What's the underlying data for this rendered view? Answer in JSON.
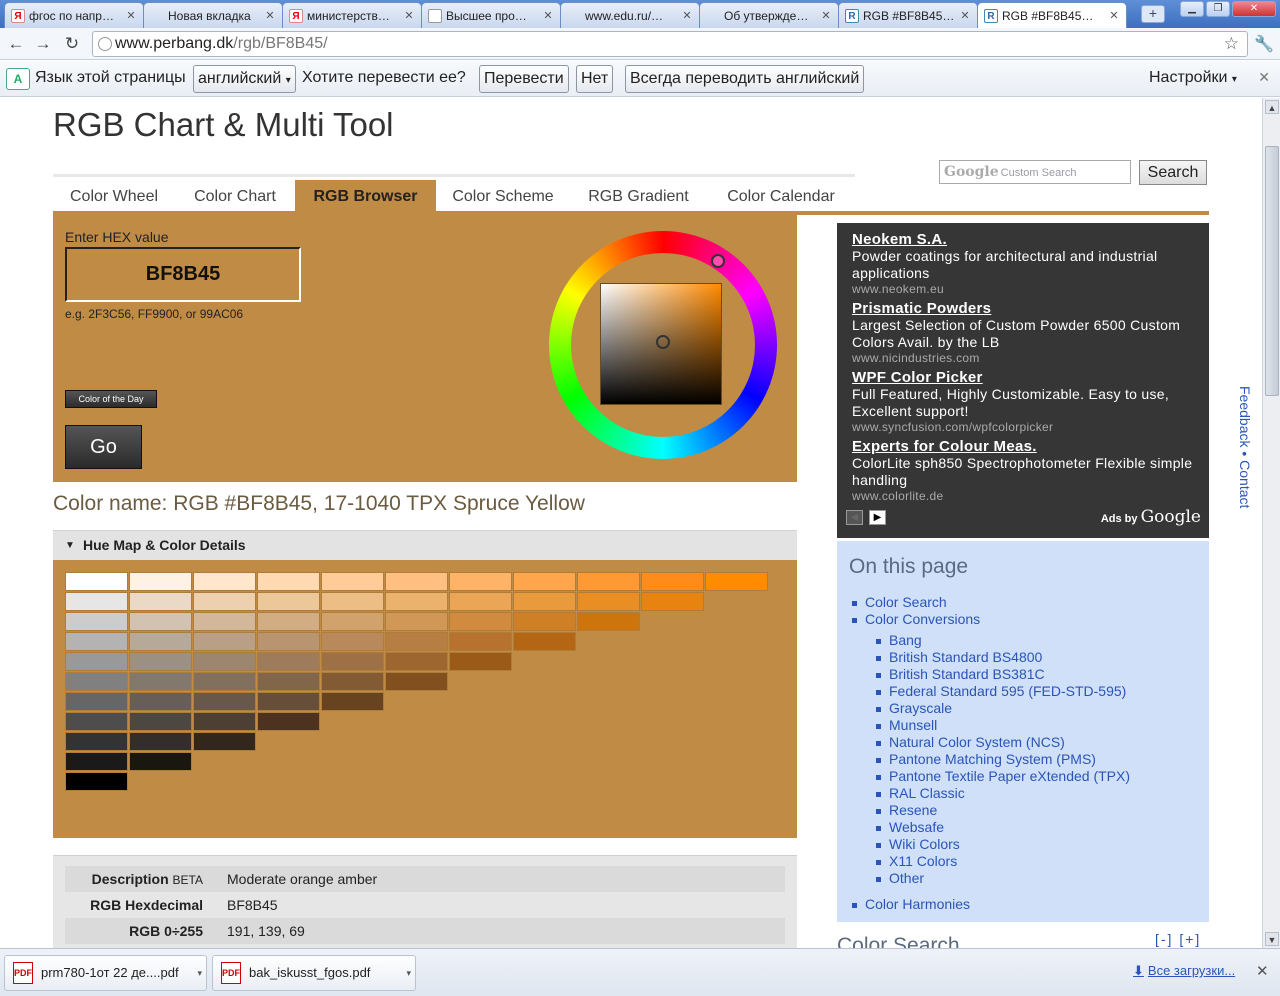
{
  "browser": {
    "tabs": [
      {
        "title": "фгос по напр…",
        "icon": "Я",
        "kind": "y"
      },
      {
        "title": "Новая вкладка",
        "icon": "",
        "kind": "e"
      },
      {
        "title": "министерств…",
        "icon": "Я",
        "kind": "y"
      },
      {
        "title": "Высшее про…",
        "icon": "",
        "kind": "d"
      },
      {
        "title": "www.edu.ru/…",
        "icon": "",
        "kind": "e"
      },
      {
        "title": "Об утвержде…",
        "icon": "",
        "kind": "e"
      },
      {
        "title": "RGB #BF8B45…",
        "icon": "R",
        "kind": "r"
      },
      {
        "title": "RGB #BF8B45…",
        "icon": "R",
        "kind": "r",
        "active": true
      }
    ],
    "newtab_label": "+",
    "url_domain": "www.perbang.dk",
    "url_path": "/rgb/BF8B45/"
  },
  "translate_bar": {
    "prompt": "Язык этой страницы",
    "language": "английский",
    "question": "Хотите перевести ее?",
    "translate": "Перевести",
    "no": "Нет",
    "always": "Всегда переводить английский",
    "settings": "Настройки"
  },
  "site": {
    "title": "RGB Chart & Multi Tool",
    "search_logo": "Google",
    "search_placeholder": "Custom Search",
    "search_button": "Search",
    "nav": [
      "Color Wheel",
      "Color Chart",
      "RGB Browser",
      "Color Scheme",
      "RGB Gradient",
      "Color Calendar"
    ],
    "nav_active": 2
  },
  "tool": {
    "hex_label": "Enter HEX value",
    "hex_value": "BF8B45",
    "hex_example": "e.g. 2F3C56, FF9900, or 99AC06",
    "cotd_label": "Color of the Day",
    "go_label": "Go",
    "color": "#bf8b45"
  },
  "color_name": "Color name: RGB #BF8B45, 17-1040 TPX Spruce Yellow",
  "huemap": {
    "header": "Hue Map & Color Details",
    "rows": [
      [
        "#ffffff",
        "#fff2e5",
        "#ffe6cc",
        "#ffd9b2",
        "#ffcc99",
        "#ffbf80",
        "#ffb366",
        "#ffa64d",
        "#ff9933",
        "#ff8c1a",
        "#ff8c00"
      ],
      [
        "#e6e6e6",
        "#ebd9c8",
        "#ecd0b0",
        "#ecc79a",
        "#ecbd84",
        "#ebb26d",
        "#eaa656",
        "#e99a3d",
        "#e88e24",
        "#e7840f"
      ],
      [
        "#cccccc",
        "#d1c2b1",
        "#d2b79a",
        "#d2ad84",
        "#d2a26d",
        "#d19756",
        "#d08b3f",
        "#cf7f26",
        "#ce740c"
      ],
      [
        "#b3b3b3",
        "#b7a99a",
        "#b89f86",
        "#b89470",
        "#b8895a",
        "#b77e44",
        "#b6722e",
        "#b56614"
      ],
      [
        "#999999",
        "#9c9083",
        "#9d8670",
        "#9d7b5b",
        "#9d7046",
        "#9d6530",
        "#9b5a17"
      ],
      [
        "#808080",
        "#82786d",
        "#82705e",
        "#826649",
        "#825b35",
        "#82501f"
      ],
      [
        "#666666",
        "#675f57",
        "#67584a",
        "#674e38",
        "#67441f"
      ],
      [
        "#4d4d4d",
        "#4d4741",
        "#4d3f33",
        "#4d3220"
      ],
      [
        "#333333",
        "#332e2a",
        "#33271b"
      ],
      [
        "#1a1a1a",
        "#1a1610"
      ],
      [
        "#000000"
      ]
    ]
  },
  "details": [
    {
      "key": "Description",
      "beta": "BETA",
      "value": "Moderate orange amber"
    },
    {
      "key": "RGB Hexdecimal",
      "value": "BF8B45"
    },
    {
      "key": "RGB 0÷255",
      "value": "191, 139, 69"
    }
  ],
  "ads": [
    {
      "title": "Neokem S.A.",
      "body": "Powder coatings for architectural and industrial applications",
      "url": "www.neokem.eu"
    },
    {
      "title": "Prismatic Powders",
      "body": "Largest Selection of Custom Powder 6500 Custom Colors Avail. by the LB",
      "url": "www.nicindustries.com"
    },
    {
      "title": "WPF Color Picker",
      "body": "Full Featured, Highly Customizable. Easy to use, Excellent support!",
      "url": "www.syncfusion.com/wpfcolorpicker"
    },
    {
      "title": "Experts for Colour Meas.",
      "body": "ColorLite sph850 Spectrophotometer Flexible simple handling",
      "url": "www.colorlite.de"
    }
  ],
  "ads_by": "Ads by",
  "ads_brand": "Google",
  "on_this_page": {
    "title": "On this page",
    "items": [
      {
        "label": "Color Search",
        "level": 0
      },
      {
        "label": "Color Conversions",
        "level": 0
      },
      {
        "label": "Bang",
        "level": 1
      },
      {
        "label": "British Standard BS4800",
        "level": 1
      },
      {
        "label": "British Standard BS381C",
        "level": 1
      },
      {
        "label": "Federal Standard 595 (FED-STD-595)",
        "level": 1
      },
      {
        "label": "Grayscale",
        "level": 1
      },
      {
        "label": "Munsell",
        "level": 1
      },
      {
        "label": "Natural Color System (NCS)",
        "level": 1
      },
      {
        "label": "Pantone Matching System (PMS)",
        "level": 1
      },
      {
        "label": "Pantone Textile Paper eXtended (TPX)",
        "level": 1
      },
      {
        "label": "RAL Classic",
        "level": 1
      },
      {
        "label": "Resene",
        "level": 1
      },
      {
        "label": "Websafe",
        "level": 1
      },
      {
        "label": "Wiki Colors",
        "level": 1
      },
      {
        "label": "X11 Colors",
        "level": 1
      },
      {
        "label": "Other",
        "level": 1
      },
      {
        "label": "Color Harmonies",
        "level": 0,
        "gap": true
      }
    ]
  },
  "color_search_heading": "Color Search",
  "expand_collapse": "[-] [+]",
  "feedback": "Feedback • Contact",
  "downloads": {
    "items": [
      {
        "name": "prm780-1от 22 де....pdf"
      },
      {
        "name": "bak_iskusst_fgos.pdf"
      }
    ],
    "all": "Все загрузки..."
  }
}
